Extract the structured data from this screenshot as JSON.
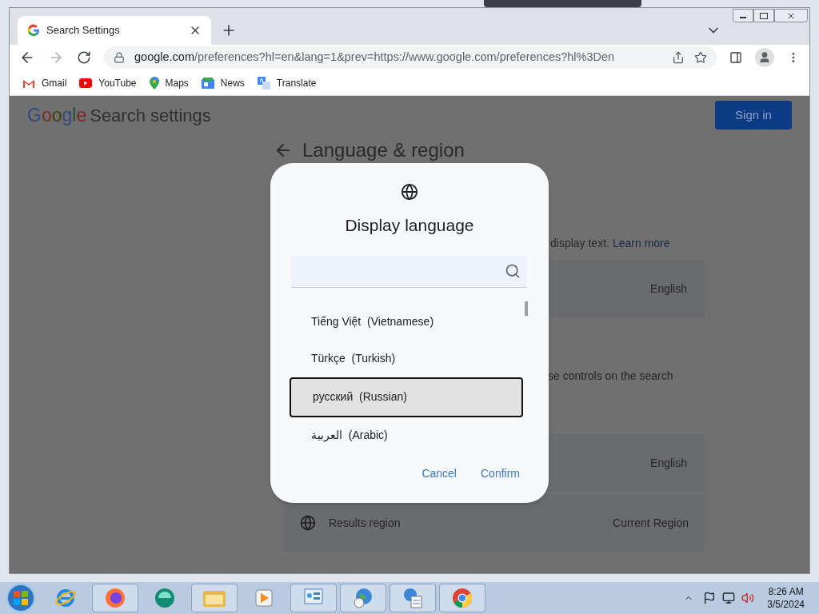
{
  "browser": {
    "tabs": [
      {
        "title": "Search Settings",
        "selected": true
      }
    ],
    "address": {
      "domain": "google.com",
      "path": "/preferences?hl=en&lang=1&prev=https://www.google.com/preferences?hl%3Den"
    },
    "bookmarks": [
      {
        "label": "Gmail"
      },
      {
        "label": "YouTube"
      },
      {
        "label": "Maps"
      },
      {
        "label": "News"
      },
      {
        "label": "Translate"
      }
    ]
  },
  "page": {
    "logo": "Google",
    "title": "Search settings",
    "sign_in": "Sign in",
    "heading": "Language & region",
    "intro": "display text.",
    "learn_more": "Learn more",
    "rows": [
      {
        "kind": "value",
        "value": "English"
      },
      {
        "kind": "text",
        "text": "se controls on the search"
      },
      {
        "kind": "value",
        "value": "English"
      },
      {
        "kind": "labeled",
        "label": "Results region",
        "value": "Current Region"
      }
    ]
  },
  "dialog": {
    "title": "Display language",
    "languages": [
      {
        "name": "Tiếng Việt  (Vietnamese)",
        "selected": false
      },
      {
        "name": "Türkçe  (Turkish)",
        "selected": false
      },
      {
        "name": "русский  (Russian)",
        "selected": true
      },
      {
        "name": "العربية  (Arabic)",
        "selected": false
      }
    ],
    "buttons": [
      "Cancel",
      "Confirm"
    ]
  },
  "taskbar": {
    "time": "8:26 AM",
    "date": "3/5/2024"
  }
}
